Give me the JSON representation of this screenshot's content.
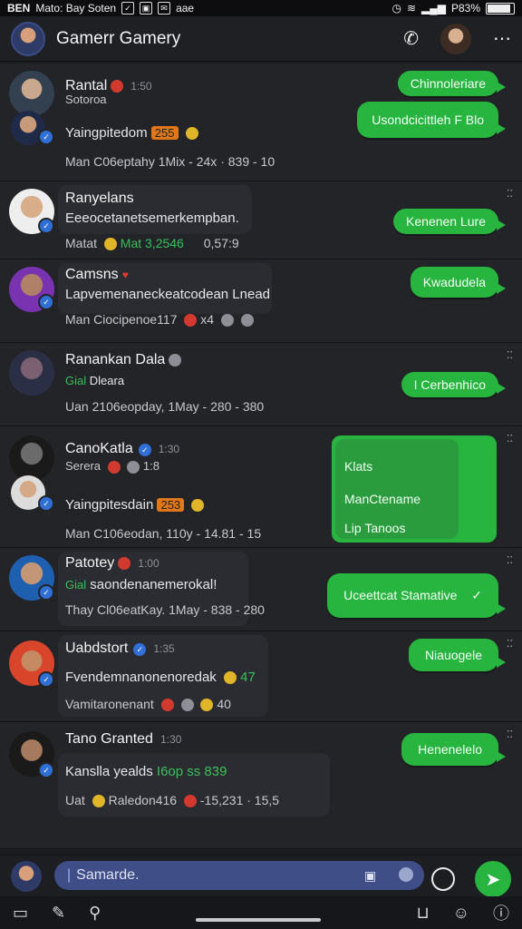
{
  "status_bar": {
    "left_text": "BEN",
    "carrier": "Mato: Bay Soten",
    "extra": "aae",
    "battery": "P83%",
    "battery_level": 0.83
  },
  "header": {
    "title": "Gamerr Gamery"
  },
  "chats": [
    {
      "name": "Rantal",
      "time": "1:50",
      "line2": "Sotoroa",
      "line3_text": "Yaingpitedom",
      "line3_chip": "255",
      "meta": "Man C06eptahy 1Mix - 24x · 839 - 10",
      "bubbles": [
        "Chinnoleriare",
        "Usondcicittleh F Blo"
      ]
    },
    {
      "name": "Ranyelans",
      "preview": "Eeeocetanetsemerkempban.",
      "meta_left": "Matat",
      "meta_green": "Mat 3,2546",
      "meta_right": "0,57:9",
      "bubbles": [
        "Kenenen Lure"
      ]
    },
    {
      "name": "Camsns",
      "preview": "Lapvemenaneckeatcodean Lnead",
      "meta": "Man Ciocipenoe117",
      "meta_extra": "x4",
      "bubbles": [
        "Kwadudela"
      ]
    },
    {
      "name": "Ranankan Dala",
      "preview_green": "Gial",
      "preview": "Dleara",
      "meta": "Uan 2106eopday, 1May - 280 - 380",
      "bubbles": [
        "I Cerbenhico"
      ]
    },
    {
      "name": "CanoKatla",
      "time": "1:30",
      "line2": "Serera",
      "line2_extra": "1:8",
      "line3_text": "Yaingpitesdain",
      "line3_chip": "253",
      "meta": "Man C106eodan, 110y - 14.81 - 15",
      "bubbles": [
        "Klats",
        "ManCtename",
        "Lip Tanoos"
      ]
    },
    {
      "name": "Patotey",
      "time": "1:00",
      "preview_green": "Gial",
      "preview": "saondenanemerokal!",
      "meta": "Thay Cl06eatKay. 1May - 838 - 280",
      "bubbles": [
        "Uceettcat Stamative"
      ]
    },
    {
      "name": "Uabdstort",
      "time": "1:35",
      "preview": "Fvendemnanonenoredak",
      "preview_extra": "47",
      "meta": "Vamitaronenant",
      "meta_extra": "40",
      "bubbles": [
        "Niauogele"
      ]
    },
    {
      "name": "Tano Granted",
      "time": "1:30",
      "preview": "Kanslla yealds",
      "preview_green": "I6op ss 839",
      "meta_left": "Uat",
      "meta": "Raledon416",
      "meta_right": "-15,231 · 15,5",
      "bubbles": [
        "Henenelelo"
      ]
    }
  ],
  "composer": {
    "placeholder": "Samarde."
  }
}
